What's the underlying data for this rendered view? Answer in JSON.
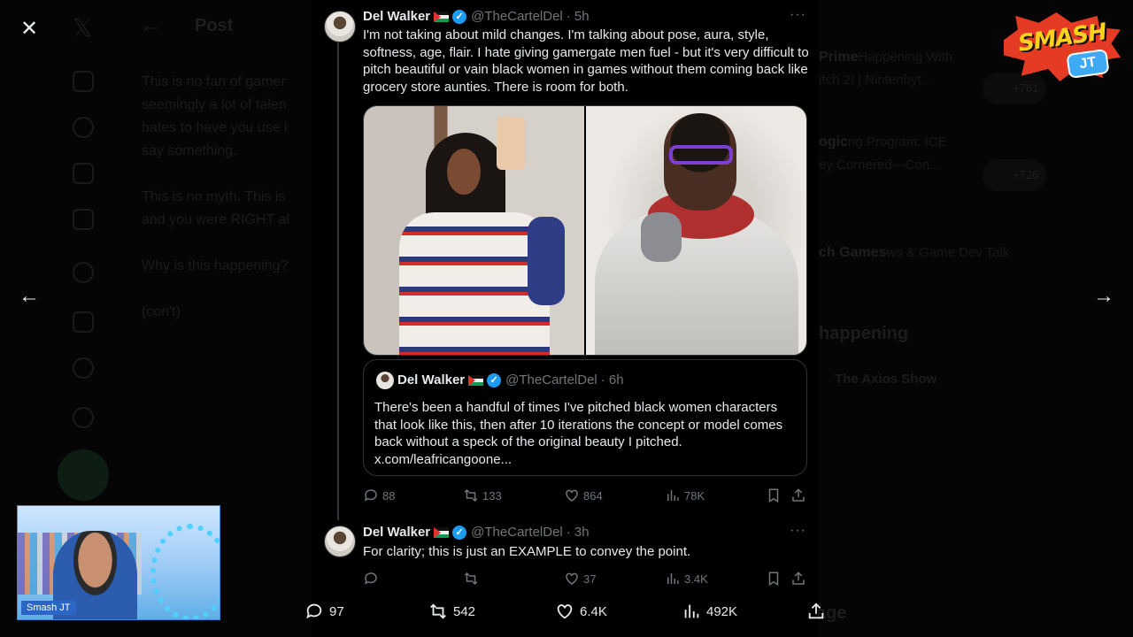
{
  "background": {
    "post_title": "Post",
    "left_text": [
      "This is no fan of gamer",
      "seemingly a lot of talen",
      "hates to have you use i",
      "say something.",
      "",
      "This is no myth. This is",
      "and you were RIGHT al",
      "",
      "Why is this happening?",
      "",
      "(con't)"
    ],
    "right_rows": [
      {
        "bold": "Prime",
        "text": "Happening With"
      },
      {
        "bold": "",
        "text": "itch 2! | Nintenbyt..."
      },
      {
        "bold": "ogic",
        "text": "ng Program: ICE"
      },
      {
        "bold": "",
        "text": "ey Cornered—Con..."
      },
      {
        "bold": "ch Games",
        "text": "ws & Game Dev Talk"
      }
    ],
    "right_heading": "happening",
    "right_item": "The Axios Show",
    "right_counts": [
      "+761",
      "+726"
    ],
    "messages_label": "Message"
  },
  "tweet1": {
    "name": "Del Walker",
    "handle": "@TheCartelDel",
    "time": "· 5h",
    "text": "I'm not taking about mild changes. I'm talking about pose, aura, style, softness, age, flair. I hate giving gamergate men fuel - but it's very difficult to pitch beautiful or vain black women in games without them coming back like grocery store aunties. There is room for both.",
    "quote": {
      "name": "Del Walker",
      "handle": "@TheCartelDel",
      "time": "· 6h",
      "text": "There's been a handful of times I've pitched black women characters that look like this, then after 10 iterations the concept or model comes back without a speck of the original beauty I pitched. x.com/leafricangoone..."
    },
    "stats": {
      "replies": "88",
      "reposts": "133",
      "likes": "864",
      "views": "78K"
    }
  },
  "tweet2": {
    "name": "Del Walker",
    "handle": "@TheCartelDel",
    "time": "· 3h",
    "text": "For clarity; this is just an EXAMPLE to convey the point.",
    "stats": {
      "replies": "",
      "reposts": "",
      "likes": "37",
      "views": "3.4K"
    }
  },
  "bottom_stats": {
    "replies": "97",
    "reposts": "542",
    "likes": "6.4K",
    "views": "492K"
  },
  "webcam": {
    "label": "Smash JT"
  },
  "logo": {
    "word": "SMASH",
    "badge": "JT"
  },
  "colors": {
    "accent": "#1d9bf0",
    "muted": "#71767b",
    "text": "#e7e9ea",
    "border": "#2f3336"
  }
}
